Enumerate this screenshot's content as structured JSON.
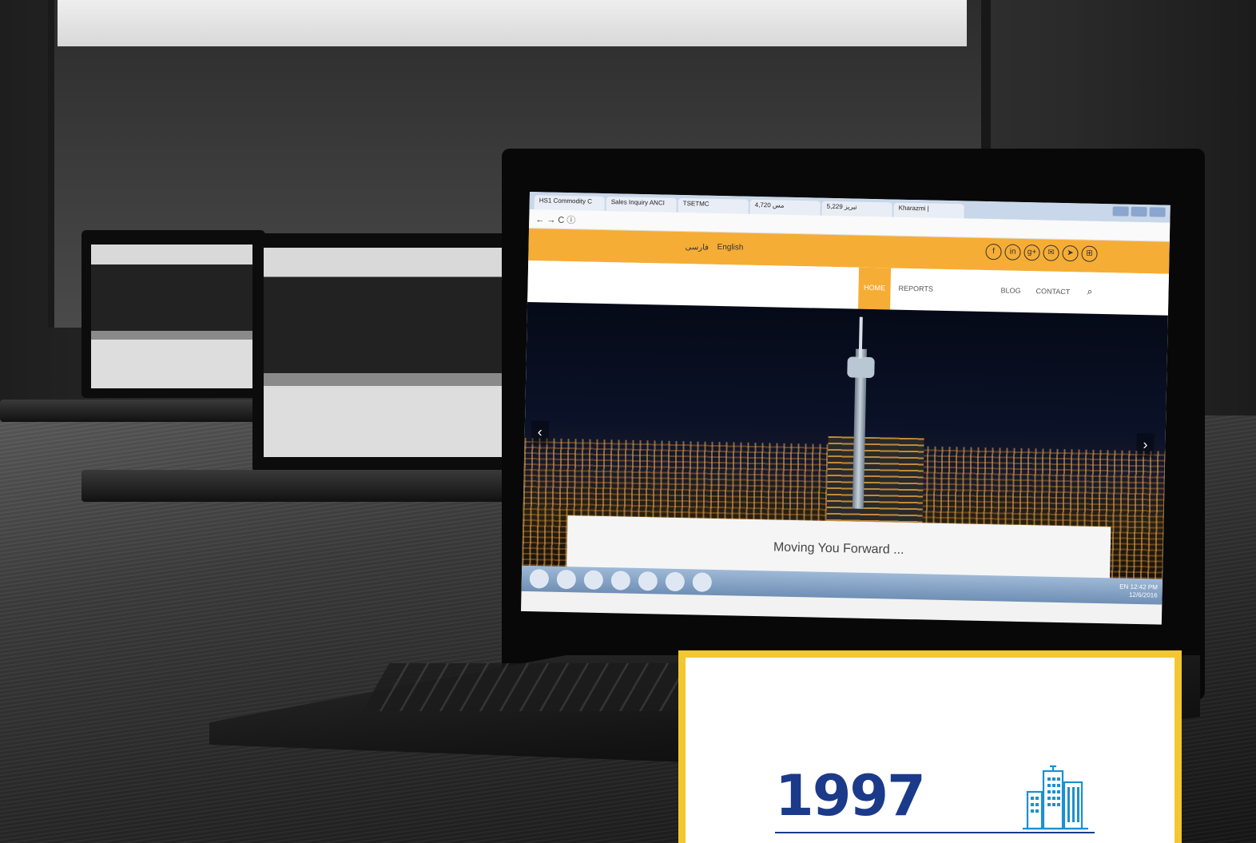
{
  "browser": {
    "tabs": [
      "HS1 Commodity C",
      "Sales Inquiry ANCI",
      "TSETMC",
      "4,720 مس",
      "5,229 تبریز",
      "Kharazmi |"
    ],
    "address_icons": "← → C ⓘ"
  },
  "site": {
    "lang_fa": "فارسی",
    "lang_en": "English",
    "social_icons": [
      "f",
      "in",
      "g+",
      "✉",
      "➤",
      "⊞"
    ],
    "nav": {
      "home": "HOME",
      "reports": "REPORTS",
      "blog": "BLOG",
      "contact": "CONTACT",
      "search": "⌕"
    },
    "hero_prev": "‹",
    "hero_next": "›",
    "tagline": "Moving You Forward ..."
  },
  "taskbar": {
    "lang": "EN",
    "time": "12:42 PM",
    "date": "12/6/2016"
  },
  "card": {
    "year": "1997",
    "icon": "buildings-icon",
    "accent_color": "#f3c72f",
    "text_color": "#1b3a8a"
  }
}
